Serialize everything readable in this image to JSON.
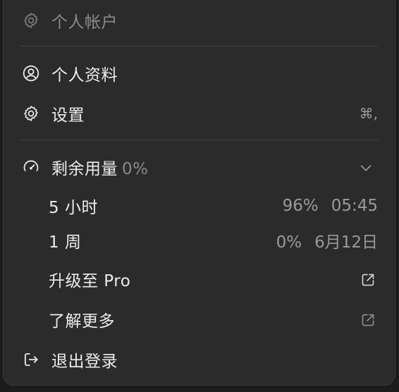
{
  "header": {
    "title": "个人帐户",
    "icon": "gear-icon"
  },
  "items": {
    "profile": {
      "label": "个人资料",
      "icon": "user-circle-icon"
    },
    "settings": {
      "label": "设置",
      "shortcut": "⌘,",
      "icon": "gear-icon"
    }
  },
  "usage": {
    "label": "剩余用量",
    "percent": "0%",
    "icon": "gauge-icon",
    "toggle_icon": "chevron-down-icon",
    "rows": [
      {
        "label": "5 小时",
        "percent": "96%",
        "reset": "05:45"
      },
      {
        "label": "1 周",
        "percent": "0%",
        "reset": "6月12日"
      }
    ]
  },
  "links": {
    "upgrade": {
      "label": "升级至 Pro",
      "icon": "external-link-icon"
    },
    "learn_more": {
      "label": "了解更多",
      "icon": "external-link-icon"
    }
  },
  "logout": {
    "label": "退出登录",
    "icon": "logout-icon"
  }
}
